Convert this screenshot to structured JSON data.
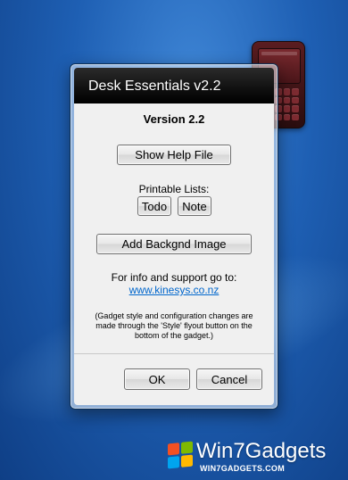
{
  "dialog": {
    "title": "Desk Essentials v2.2",
    "version": "Version 2.2",
    "help_button": "Show Help File",
    "printable_lists_label": "Printable Lists:",
    "todo_button": "Todo",
    "note_button": "Note",
    "background_button": "Add Backgnd Image",
    "info_label": "For info and support go to:",
    "support_link": "www.kinesys.co.nz",
    "note_text": "(Gadget style and configuration changes are made through the 'Style' flyout button on the bottom of the gadget.)",
    "ok_button": "OK",
    "cancel_button": "Cancel"
  },
  "watermark": {
    "brand": "Win7Gadgets",
    "url": "WIN7GADGETS.COM"
  },
  "icons": [
    "phone-gadget-icon",
    "windows-flag-icon"
  ],
  "colors": {
    "desktop_blue": "#1e5fb3",
    "titlebar": "#121212",
    "link": "#0066cc",
    "gadget": "#5a1d20"
  }
}
